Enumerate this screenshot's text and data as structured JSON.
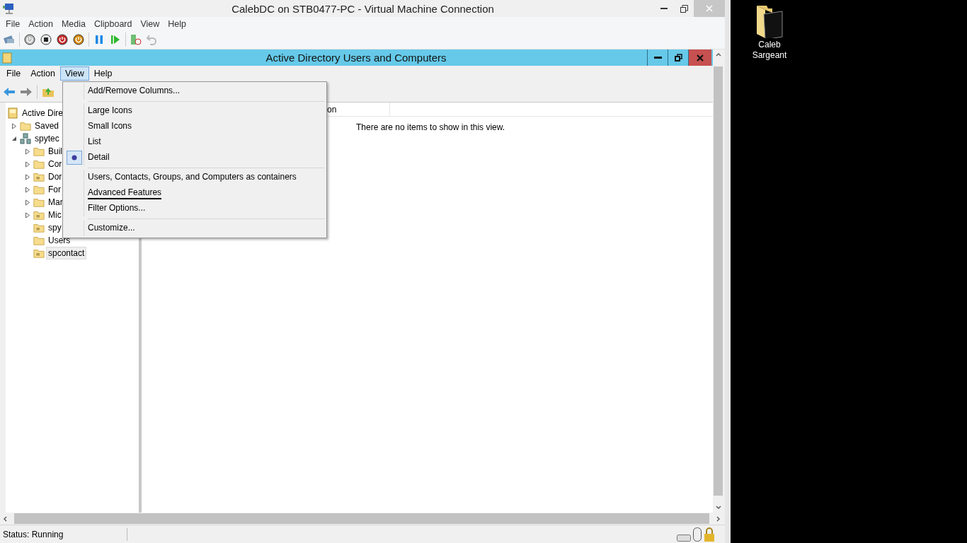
{
  "vm_window": {
    "title": "CalebDC on STB0477-PC - Virtual Machine Connection",
    "menu": [
      "File",
      "Action",
      "Media",
      "Clipboard",
      "View",
      "Help"
    ]
  },
  "vm_toolbar": [
    {
      "kind": "ctrl-alt-del",
      "disabled": false
    },
    {
      "kind": "separator"
    },
    {
      "kind": "start",
      "disabled": true
    },
    {
      "kind": "turn-off",
      "disabled": false
    },
    {
      "kind": "shut-down",
      "disabled": false
    },
    {
      "kind": "save",
      "disabled": false
    },
    {
      "kind": "separator"
    },
    {
      "kind": "pause",
      "disabled": false
    },
    {
      "kind": "reset",
      "disabled": false
    },
    {
      "kind": "separator"
    },
    {
      "kind": "checkpoint",
      "disabled": false
    },
    {
      "kind": "revert",
      "disabled": true
    }
  ],
  "aduc_window": {
    "title": "Active Directory Users and Computers",
    "menu": [
      {
        "label": "File",
        "selected": false
      },
      {
        "label": "Action",
        "selected": false
      },
      {
        "label": "View",
        "selected": true
      },
      {
        "label": "Help",
        "selected": false
      }
    ],
    "tree": [
      {
        "label": "Active Dire",
        "kind": "root",
        "selected": false,
        "children": [
          {
            "label": "Saved",
            "kind": "folder",
            "expanded": false,
            "selected": false
          },
          {
            "label": "spytec",
            "kind": "domain",
            "expanded": true,
            "selected": false,
            "children": [
              {
                "label": "Buil",
                "kind": "folder",
                "expanded": false,
                "selected": false
              },
              {
                "label": "Cor",
                "kind": "folder",
                "expanded": false,
                "selected": false
              },
              {
                "label": "Dor",
                "kind": "ou",
                "expanded": false,
                "selected": false
              },
              {
                "label": "For",
                "kind": "folder",
                "expanded": false,
                "selected": false
              },
              {
                "label": "Mar",
                "kind": "folder",
                "expanded": false,
                "selected": false
              },
              {
                "label": "Mic",
                "kind": "ou",
                "expanded": false,
                "selected": false
              },
              {
                "label": "spy",
                "kind": "ou",
                "selected": false
              },
              {
                "label": "Users",
                "kind": "folder",
                "selected": false
              },
              {
                "label": "spcontact",
                "kind": "ou",
                "selected": true
              }
            ]
          }
        ]
      }
    ],
    "list": {
      "columns": [
        "on"
      ],
      "empty_text": "There are no items to show in this view."
    }
  },
  "view_menu": {
    "groups": [
      [
        {
          "label": "Add/Remove Columns...",
          "selected": false,
          "marked": false
        }
      ],
      [
        {
          "label": "Large Icons",
          "selected": false,
          "marked": false
        },
        {
          "label": "Small Icons",
          "selected": false,
          "marked": false
        },
        {
          "label": "List",
          "selected": false,
          "marked": false
        },
        {
          "label": "Detail",
          "selected": true,
          "marked": false
        }
      ],
      [
        {
          "label": "Users, Contacts, Groups, and Computers as containers",
          "selected": false,
          "marked": false
        },
        {
          "label": "Advanced Features",
          "selected": false,
          "marked": true
        },
        {
          "label": "Filter Options...",
          "selected": false,
          "marked": false
        }
      ],
      [
        {
          "label": "Customize...",
          "selected": false,
          "marked": false
        }
      ]
    ]
  },
  "status_bar": {
    "text": "Status: Running"
  },
  "desktop": {
    "icons": [
      {
        "label": "Caleb Sargeant"
      }
    ]
  }
}
